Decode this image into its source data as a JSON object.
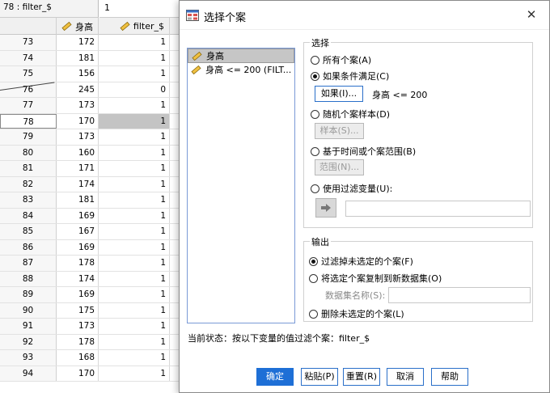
{
  "sheet": {
    "cell_ref": "78 : filter_$",
    "cell_value": "1",
    "columns": [
      "身高",
      "filter_$"
    ],
    "rows": [
      {
        "n": "73",
        "h": "172",
        "f": "1"
      },
      {
        "n": "74",
        "h": "181",
        "f": "1"
      },
      {
        "n": "75",
        "h": "156",
        "f": "1"
      },
      {
        "n": "76",
        "h": "245",
        "f": "0"
      },
      {
        "n": "77",
        "h": "173",
        "f": "1"
      },
      {
        "n": "78",
        "h": "170",
        "f": "1"
      },
      {
        "n": "79",
        "h": "173",
        "f": "1"
      },
      {
        "n": "80",
        "h": "160",
        "f": "1"
      },
      {
        "n": "81",
        "h": "171",
        "f": "1"
      },
      {
        "n": "82",
        "h": "174",
        "f": "1"
      },
      {
        "n": "83",
        "h": "181",
        "f": "1"
      },
      {
        "n": "84",
        "h": "169",
        "f": "1"
      },
      {
        "n": "85",
        "h": "167",
        "f": "1"
      },
      {
        "n": "86",
        "h": "169",
        "f": "1"
      },
      {
        "n": "87",
        "h": "178",
        "f": "1"
      },
      {
        "n": "88",
        "h": "174",
        "f": "1"
      },
      {
        "n": "89",
        "h": "169",
        "f": "1"
      },
      {
        "n": "90",
        "h": "175",
        "f": "1"
      },
      {
        "n": "91",
        "h": "173",
        "f": "1"
      },
      {
        "n": "92",
        "h": "178",
        "f": "1"
      },
      {
        "n": "93",
        "h": "168",
        "f": "1"
      },
      {
        "n": "94",
        "h": "170",
        "f": "1"
      }
    ]
  },
  "dialog": {
    "title": "选择个案",
    "close": "✕",
    "variables": [
      "身高",
      "身高 <= 200 (FILT..."
    ],
    "select_group": "选择",
    "opt_all": "所有个案(A)",
    "opt_if": "如果条件满足(C)",
    "if_button": "如果(I)...",
    "if_condition": "身高 <= 200",
    "opt_random": "随机个案样本(D)",
    "sample_button": "样本(S)...",
    "opt_range": "基于时间或个案范围(B)",
    "range_button": "范围(N)...",
    "opt_filter": "使用过滤变量(U):",
    "output_group": "输出",
    "out_filter": "过滤掉未选定的个案(F)",
    "out_copy": "将选定个案复制到新数据集(O)",
    "dataset_label": "数据集名称(S):",
    "out_delete": "删除未选定的个案(L)",
    "status": "当前状态：按以下变量的值过滤个案：filter_$",
    "buttons": {
      "ok": "确定",
      "paste": "粘贴(P)",
      "reset": "重置(R)",
      "cancel": "取消",
      "help": "帮助"
    }
  },
  "colors": {
    "primary": "#1e6fd6",
    "selection": "#c6c6c6"
  }
}
